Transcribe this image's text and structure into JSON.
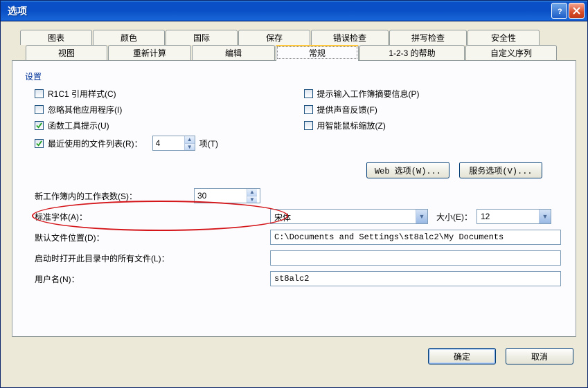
{
  "title": "选项",
  "tabs_row1": [
    "图表",
    "颜色",
    "国际",
    "保存",
    "错误检查",
    "拼写检查",
    "安全性"
  ],
  "tabs_row2": [
    "视图",
    "重新计算",
    "编辑",
    "常规",
    "1-2-3 的帮助",
    "自定义序列"
  ],
  "active_tab": "常规",
  "section": "设置",
  "checks": {
    "r1c1": {
      "label": "R1C1 引用样式(C)",
      "checked": false
    },
    "ignore_other": {
      "label": "忽略其他应用程序(I)",
      "checked": false
    },
    "func_tooltip": {
      "label": "函数工具提示(U)",
      "checked": true
    },
    "recent_files": {
      "label": "最近使用的文件列表(R)：",
      "checked": true
    },
    "prompt_summary": {
      "label": "提示输入工作簿摘要信息(P)",
      "checked": false
    },
    "sound_feedback": {
      "label": "提供声音反馈(F)",
      "checked": false
    },
    "zoom_intellimouse": {
      "label": "用智能鼠标缩放(Z)",
      "checked": false
    }
  },
  "recent_value": "4",
  "recent_suffix": "项(T)",
  "web_options_btn": "Web 选项(W)...",
  "service_options_btn": "服务选项(V)...",
  "sheets_label": "新工作簿内的工作表数(S)：",
  "sheets_value": "30",
  "std_font_label": "标准字体(A)：",
  "std_font_value": "宋体",
  "size_label": "大小(E)：",
  "size_value": "12",
  "default_loc_label": "默认文件位置(D)：",
  "default_loc_value": "C:\\Documents and Settings\\st8alc2\\My Documents",
  "startup_label": "启动时打开此目录中的所有文件(L)：",
  "startup_value": "",
  "username_label": "用户名(N)：",
  "username_value": "st8alc2",
  "ok_btn": "确定",
  "cancel_btn": "取消"
}
